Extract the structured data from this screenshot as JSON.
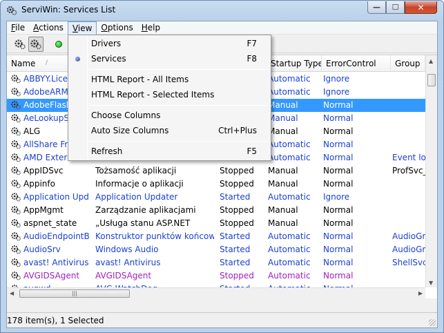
{
  "window": {
    "title": "ServiWin: Services List",
    "min_glyph": "—",
    "max_glyph": "☐",
    "close_glyph": "✕"
  },
  "menubar": {
    "items": [
      {
        "key": "F",
        "rest": "ile"
      },
      {
        "key": "A",
        "rest": "ctions"
      },
      {
        "key": "V",
        "rest": "iew"
      },
      {
        "key": "O",
        "rest": "ptions"
      },
      {
        "key": "H",
        "rest": "elp"
      }
    ]
  },
  "view_menu": {
    "drivers": {
      "label": "Drivers",
      "shortcut": "F7"
    },
    "services": {
      "label": "Services",
      "shortcut": "F8"
    },
    "html_all": {
      "label": "HTML Report - All Items"
    },
    "html_selected": {
      "label": "HTML Report - Selected Items"
    },
    "choose_columns": {
      "label": "Choose Columns"
    },
    "auto_size": {
      "label": "Auto Size Columns",
      "shortcut": "Ctrl+Plus"
    },
    "refresh": {
      "label": "Refresh",
      "shortcut": "F5"
    }
  },
  "columns": {
    "name": "Name",
    "sort_glyph": "/",
    "startup": "Startup Type",
    "errc": "ErrorControl",
    "group": "Group"
  },
  "rows": [
    {
      "name": "ABBYY.Licen",
      "disp": "",
      "status": "",
      "startup": "Automatic",
      "errc": "Ignore",
      "group": "",
      "color": "#1a3fd0"
    },
    {
      "name": "AdobeARMse",
      "disp": "",
      "status": "",
      "startup": "Automatic",
      "errc": "Ignore",
      "group": "",
      "color": "#1a3fd0"
    },
    {
      "name": "AdobeFlashP",
      "disp": "",
      "status": "",
      "startup": "Manual",
      "errc": "Normal",
      "group": "",
      "color": "#ffffff",
      "selected": true
    },
    {
      "name": "AeLookupSvc",
      "disp": "",
      "status": "",
      "startup": "Manual",
      "errc": "Normal",
      "group": "",
      "color": "#1a3fd0"
    },
    {
      "name": "ALG",
      "disp": "",
      "status": "",
      "startup": "Manual",
      "errc": "Normal",
      "group": "",
      "color": "#000000"
    },
    {
      "name": "AllShare Fra",
      "disp": "",
      "status": "",
      "startup": "Automatic",
      "errc": "Normal",
      "group": "",
      "color": "#1a3fd0"
    },
    {
      "name": "AMD Extern",
      "disp": "",
      "status": "",
      "startup": "Automatic",
      "errc": "Normal",
      "group": "Event log",
      "color": "#1a3fd0"
    },
    {
      "name": "AppIDSvc",
      "disp": "Tożsamość aplikacji",
      "status": "Stopped",
      "startup": "Manual",
      "errc": "Normal",
      "group": "ProfSvc_G",
      "color": "#000000"
    },
    {
      "name": "Appinfo",
      "disp": "Informacje o aplikacji",
      "status": "Stopped",
      "startup": "Manual",
      "errc": "Normal",
      "group": "",
      "color": "#000000"
    },
    {
      "name": "Application Upd...",
      "disp": "Application Updater",
      "status": "Started",
      "startup": "Automatic",
      "errc": "Ignore",
      "group": "",
      "color": "#1a3fd0"
    },
    {
      "name": "AppMgmt",
      "disp": "Zarządzanie aplikacjami",
      "status": "Stopped",
      "startup": "Manual",
      "errc": "Normal",
      "group": "",
      "color": "#000000"
    },
    {
      "name": "aspnet_state",
      "disp": "„Usługa stanu ASP.NET",
      "status": "Stopped",
      "startup": "Manual",
      "errc": "Normal",
      "group": "",
      "color": "#000000"
    },
    {
      "name": "AudioEndpointB...",
      "disp": "Konstruktor punktów końcow...",
      "status": "Started",
      "startup": "Automatic",
      "errc": "Normal",
      "group": "AudioGro",
      "color": "#1a3fd0"
    },
    {
      "name": "AudioSrv",
      "disp": "Windows Audio",
      "status": "Started",
      "startup": "Automatic",
      "errc": "Normal",
      "group": "AudioGro",
      "color": "#1a3fd0"
    },
    {
      "name": "avast! Antivirus",
      "disp": "avast! Antivirus",
      "status": "Started",
      "startup": "Automatic",
      "errc": "Normal",
      "group": "ShellSvcG",
      "color": "#1a3fd0"
    },
    {
      "name": "AVGIDSAgent",
      "disp": "AVGIDSAgent",
      "status": "Stopped",
      "startup": "Automatic",
      "errc": "Normal",
      "group": "",
      "color": "#a020c0"
    },
    {
      "name": "avgwd",
      "disp": "AVG WatchDog",
      "status": "Started",
      "startup": "Automatic",
      "errc": "Normal",
      "group": "",
      "color": "#1a3fd0"
    }
  ],
  "statusbar": {
    "text": "178 item(s), 1 Selected"
  },
  "scroll": {
    "h_grip": "|||",
    "v_up": "▲",
    "v_down": "▼",
    "h_left": "◀",
    "h_right": "▶"
  }
}
